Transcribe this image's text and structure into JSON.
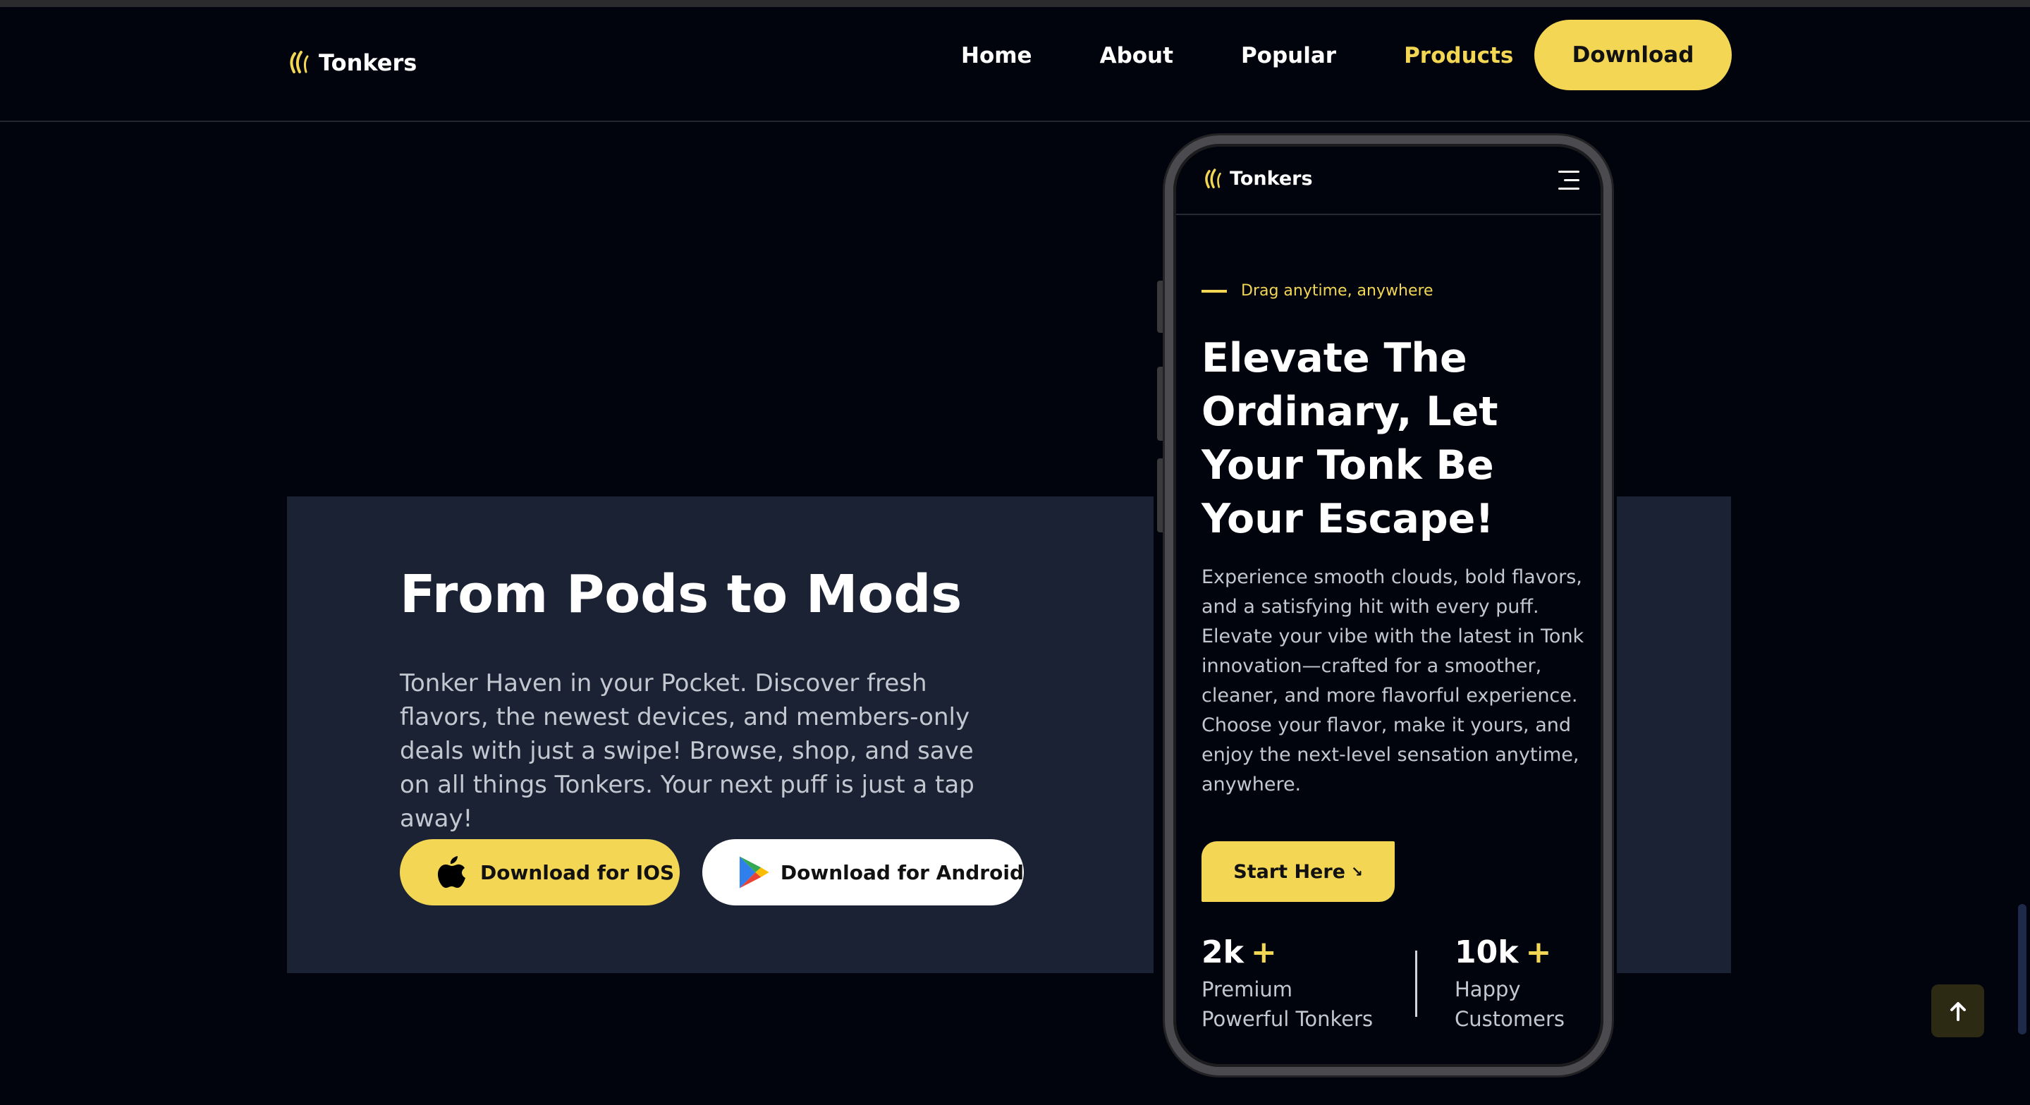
{
  "header": {
    "logo_text": "Tonkers",
    "nav": [
      {
        "label": "Home",
        "active": false
      },
      {
        "label": "About",
        "active": false
      },
      {
        "label": "Popular",
        "active": false
      },
      {
        "label": "Products",
        "active": true
      }
    ],
    "download_label": "Download"
  },
  "hero": {
    "title": "From Pods to Mods",
    "description": "Tonker Haven in your Pocket. Discover fresh flavors, the newest devices, and members-only deals with just a swipe! Browse, shop, and save on all things Tonkers. Your next puff is just a tap away!",
    "ios_label": "Download for IOS",
    "android_label": "Download for Android"
  },
  "phone": {
    "logo_text": "Tonkers",
    "eyebrow": "Drag anytime, anywhere",
    "title": "Elevate The Ordinary, Let Your Tonk Be Your Escape!",
    "description": "Experience smooth clouds, bold flavors, and a satisfying hit with every puff. Elevate your vibe with the latest in Tonk innovation—crafted for a smoother, cleaner, and more flavorful experience. Choose your flavor, make it yours, and enjoy the next-level sensation anytime, anywhere.",
    "cta_label": "Start Here",
    "cta_arrow": "↘",
    "stats": [
      {
        "value": "2k",
        "plus": "+",
        "label": "Premium Powerful Tonkers"
      },
      {
        "value": "10k",
        "plus": "+",
        "label": "Happy Customers"
      }
    ]
  },
  "colors": {
    "background": "#02040d",
    "accent": "#f2d654",
    "card": "#1a2233",
    "muted_text": "#c3c7d0"
  },
  "icons": [
    "flame-icon",
    "apple-icon",
    "google-play-icon",
    "menu-icon",
    "arrow-up-icon"
  ]
}
